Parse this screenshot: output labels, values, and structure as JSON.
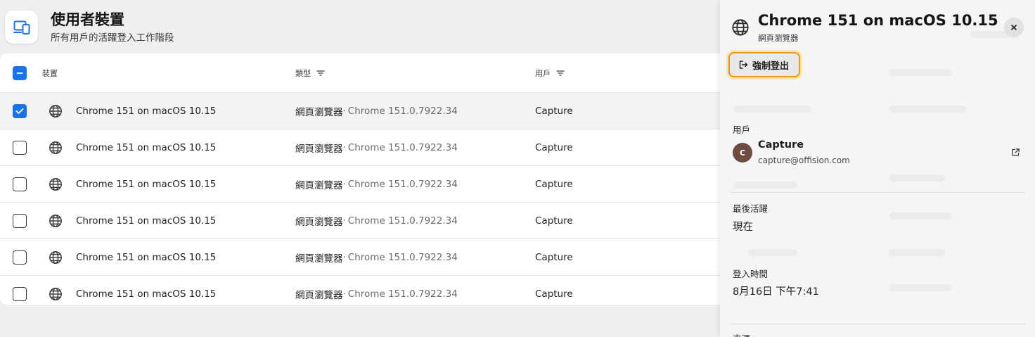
{
  "header": {
    "title": "使用者裝置",
    "subtitle": "所有用戶的活躍登入工作階段"
  },
  "table": {
    "columns": {
      "device": "裝置",
      "type": "類型",
      "user": "用戶"
    },
    "rows": [
      {
        "device": "Chrome 151 on macOS 10.15",
        "type": "網頁瀏覽器",
        "sep": "·",
        "type_detail": "Chrome 151.0.7922.34",
        "user": "Capture",
        "checked": true
      },
      {
        "device": "Chrome 151 on macOS 10.15",
        "type": "網頁瀏覽器",
        "sep": "·",
        "type_detail": "Chrome 151.0.7922.34",
        "user": "Capture",
        "checked": false
      },
      {
        "device": "Chrome 151 on macOS 10.15",
        "type": "網頁瀏覽器",
        "sep": "·",
        "type_detail": "Chrome 151.0.7922.34",
        "user": "Capture",
        "checked": false
      },
      {
        "device": "Chrome 151 on macOS 10.15",
        "type": "網頁瀏覽器",
        "sep": "·",
        "type_detail": "Chrome 151.0.7922.34",
        "user": "Capture",
        "checked": false
      },
      {
        "device": "Chrome 151 on macOS 10.15",
        "type": "網頁瀏覽器",
        "sep": "·",
        "type_detail": "Chrome 151.0.7922.34",
        "user": "Capture",
        "checked": false
      },
      {
        "device": "Chrome 151 on macOS 10.15",
        "type": "網頁瀏覽器",
        "sep": "·",
        "type_detail": "Chrome 151.0.7922.34",
        "user": "Capture",
        "checked": false
      }
    ]
  },
  "panel": {
    "title": "Chrome 151 on macOS 10.15",
    "subtitle": "網頁瀏覽器",
    "logout_label": "強制登出",
    "user_label": "用戶",
    "user_initial": "C",
    "user_name": "Capture",
    "user_email": "capture@offision.com",
    "last_active_label": "最後活躍",
    "last_active_value": "現在",
    "login_time_label": "登入時間",
    "login_time_value": "8月16日 下午7:41",
    "source_label": "來源"
  },
  "colors": {
    "accent": "#1a73e8",
    "focus_ring": "#e89a1a",
    "avatar": "#6d4c41"
  },
  "icons": {
    "app": "devices-icon",
    "row": "globe-icon",
    "filter": "filter-icon",
    "close": "close-icon",
    "logout": "logout-icon",
    "external": "external-link-icon"
  }
}
